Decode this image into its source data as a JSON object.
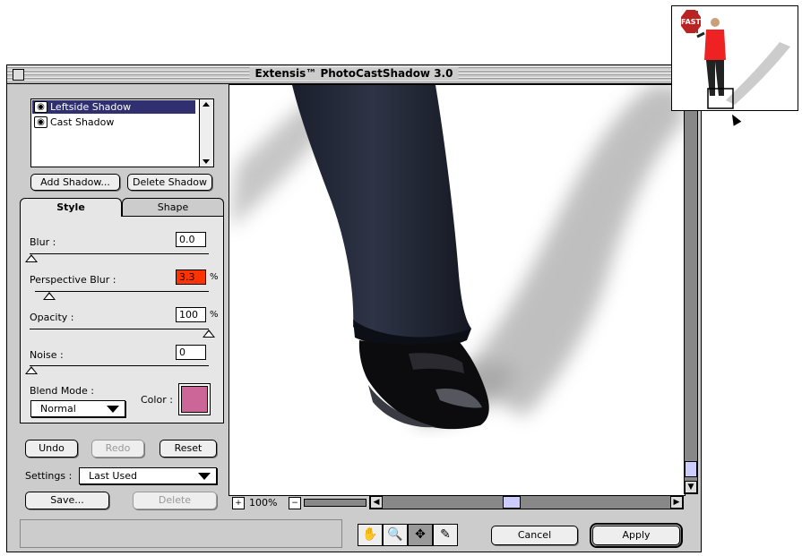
{
  "window": {
    "title": "Extensis™ PhotoCastShadow 3.0"
  },
  "shadows": {
    "items": [
      {
        "label": "Leftside Shadow",
        "selected": true
      },
      {
        "label": "Cast Shadow",
        "selected": false
      }
    ],
    "add_label": "Add Shadow...",
    "delete_label": "Delete Shadow"
  },
  "tabs": [
    {
      "label": "Style",
      "active": true
    },
    {
      "label": "Shape",
      "active": false
    }
  ],
  "style": {
    "blur": {
      "label": "Blur :",
      "value": "0.0"
    },
    "perspective_blur": {
      "label": "Perspective Blur :",
      "value": "3.3",
      "unit": "%"
    },
    "opacity": {
      "label": "Opacity :",
      "value": "100",
      "unit": "%"
    },
    "noise": {
      "label": "Noise :",
      "value": "0"
    },
    "blend_mode": {
      "label": "Blend Mode :",
      "value": "Normal"
    },
    "color": {
      "label": "Color :",
      "value": "#cc6699"
    }
  },
  "actions": {
    "undo": "Undo",
    "redo": "Redo",
    "reset": "Reset"
  },
  "settings": {
    "label": "Settings :",
    "value": "Last Used",
    "save": "Save...",
    "delete": "Delete"
  },
  "zoom": {
    "level": "100%"
  },
  "buttons": {
    "cancel": "Cancel",
    "apply": "Apply"
  },
  "preview": {
    "sign_text": "FAST"
  },
  "colors": {
    "selection": "#303070",
    "perspective_field": "#ff3300",
    "scroll_thumb": "#ccccff"
  }
}
